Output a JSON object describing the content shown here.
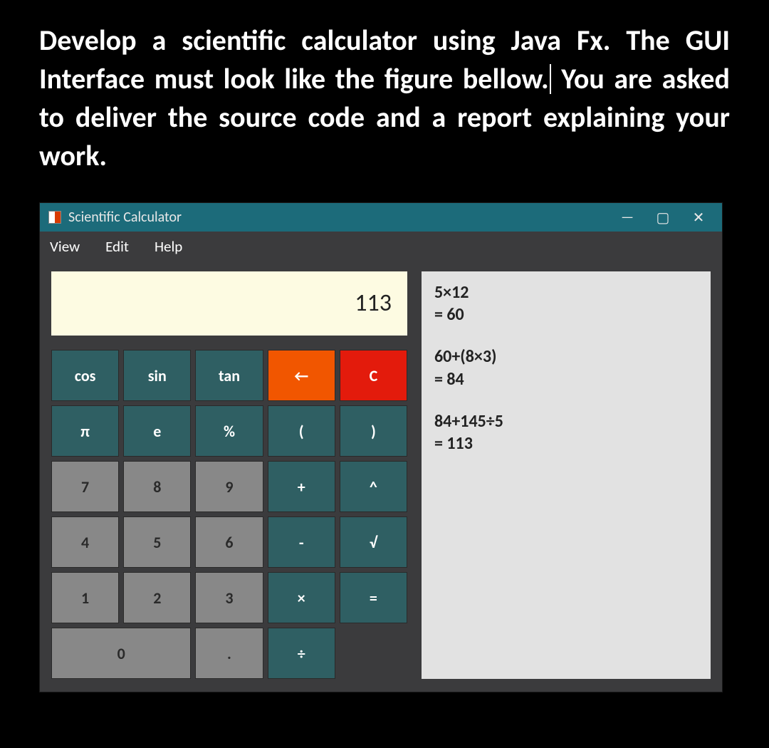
{
  "instruction": {
    "part1": "Develop a scientific calculator using Java Fx. The GUI Interface must look like the figure bellow.",
    "part2": " You are asked to deliver the source code and a report explaining your work."
  },
  "window": {
    "title": "Scientific Calculator",
    "controls": {
      "minimize": "—",
      "maximize": "▢",
      "close": "✕"
    }
  },
  "menubar": [
    "View",
    "Edit",
    "Help"
  ],
  "display": "113",
  "keys": {
    "r1c1": "cos",
    "r1c2": "sin",
    "r1c3": "tan",
    "r1c4": "←",
    "r1c5": "C",
    "r2c1": "π",
    "r2c2": "e",
    "r2c3": "%",
    "r2c4": "(",
    "r2c5": ")",
    "r3c1": "7",
    "r3c2": "8",
    "r3c3": "9",
    "r3c4": "+",
    "r3c5": "^",
    "r4c1": "4",
    "r4c2": "5",
    "r4c3": "6",
    "r4c4": "-",
    "r4c5": "√",
    "r5c1": "1",
    "r5c2": "2",
    "r5c3": "3",
    "r5c4": "×",
    "r5c5": "=",
    "r6c1": "0",
    "r6c3": ".",
    "r6c4": "÷"
  },
  "history": [
    {
      "expr": "5×12",
      "result": "= 60"
    },
    {
      "expr": "60+(8×3)",
      "result": "= 84"
    },
    {
      "expr": "84+145÷5",
      "result": "= 113"
    }
  ]
}
